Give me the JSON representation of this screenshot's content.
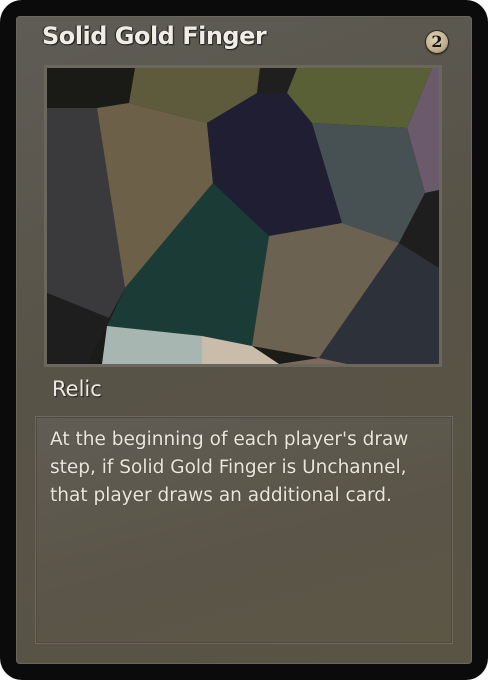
{
  "card": {
    "name": "Solid Gold Finger",
    "cost": "2",
    "type": "Relic",
    "rules_text": "At the beginning of each player's draw step, if Solid Gold Finger is Unchannel, that player draws an additional card."
  },
  "art": {
    "style": "voronoi-polygon-mosaic",
    "colors": [
      "#1b1b18",
      "#5e5a3c",
      "#1f1e33",
      "#5a6036",
      "#6a5a6b",
      "#3a3a3d",
      "#6c6048",
      "#475052",
      "#1a3b36",
      "#6b6252",
      "#2d3139",
      "#1e1e1e",
      "#a7b6b0",
      "#c9bcaa"
    ]
  },
  "colors": {
    "border": "#0b0b0b",
    "frame": "#5a564c",
    "title_text": "#f1ede4",
    "cost_circle": "#c7b796"
  }
}
